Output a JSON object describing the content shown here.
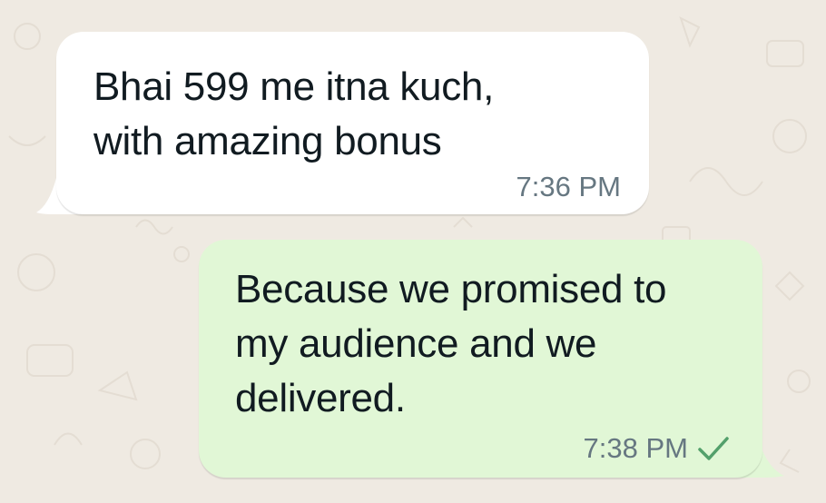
{
  "chat": {
    "messages": [
      {
        "direction": "incoming",
        "text": "Bhai 599 me itna kuch,\nwith amazing bonus",
        "time": "7:36 PM"
      },
      {
        "direction": "outgoing",
        "text": "Because we promised to\nmy audience and we\ndelivered.",
        "time": "7:38 PM",
        "status_icon": "single-check-icon"
      }
    ]
  },
  "colors": {
    "wallpaper": "#efeae2",
    "incoming_bubble": "#ffffff",
    "outgoing_bubble": "#e1f7d6",
    "text": "#111b21",
    "meta_text": "#667781",
    "check": "#53a06b"
  }
}
